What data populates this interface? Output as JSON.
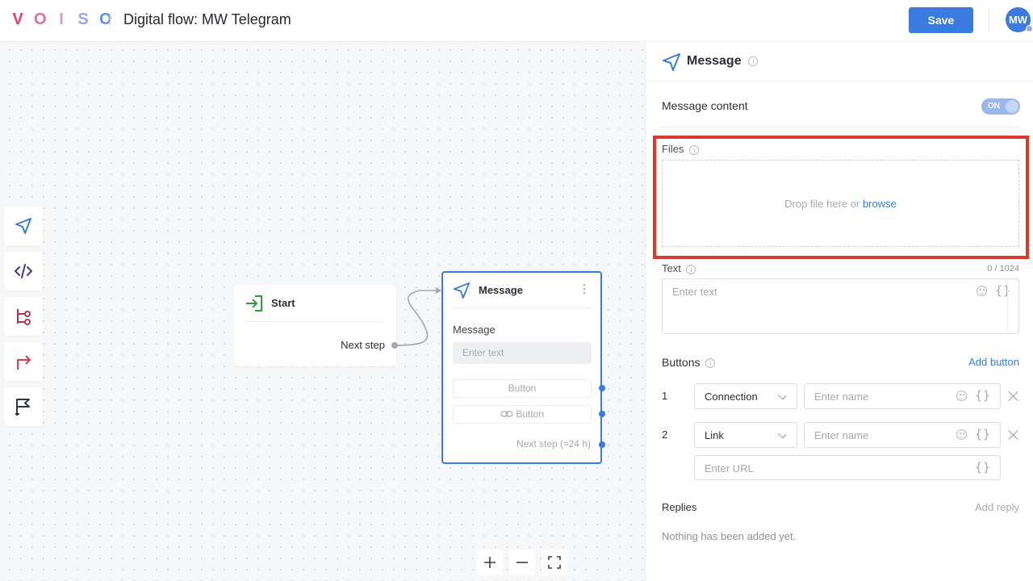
{
  "header": {
    "logo_letters": [
      "V",
      "O",
      "I",
      "S",
      "O"
    ],
    "logo_colors": [
      "#ee3a74",
      "#e66aa8",
      "#c99be8",
      "#9ea2ee",
      "#5b93ee"
    ],
    "title": "Digital flow: MW Telegram",
    "save_label": "Save",
    "avatar_initials": "MW"
  },
  "toolbar": {
    "tools": [
      {
        "icon": "send-icon",
        "label": "Message"
      },
      {
        "icon": "code-icon",
        "label": "Code"
      },
      {
        "icon": "branch-icon",
        "label": "Condition"
      },
      {
        "icon": "redirect-icon",
        "label": "Jump"
      },
      {
        "icon": "flag-icon",
        "label": "Finish"
      }
    ]
  },
  "canvas": {
    "start_node": {
      "title": "Start",
      "next_label": "Next step"
    },
    "message_node": {
      "title": "Message",
      "message_label": "Message",
      "message_placeholder": "Enter text",
      "buttons": [
        "Button",
        "Button"
      ],
      "next_label": "Next step (≈24 h)"
    },
    "zoom_controls": [
      "zoom-in",
      "zoom-out",
      "fit-view"
    ]
  },
  "panel": {
    "title": "Message",
    "message_content_label": "Message content",
    "toggle_label": "ON",
    "toggle_on": true,
    "files_label": "Files",
    "dropzone_text": "Drop file here or ",
    "dropzone_link": "browse",
    "text_label": "Text",
    "text_counter": "0 / 1024",
    "text_placeholder": "Enter text",
    "buttons_label": "Buttons",
    "add_button_label": "Add button",
    "button_rows": [
      {
        "index": "1",
        "type": "Connection",
        "name_placeholder": "Enter name"
      },
      {
        "index": "2",
        "type": "Link",
        "name_placeholder": "Enter name",
        "url_placeholder": "Enter URL"
      }
    ],
    "braces_glyph": "{}",
    "replies_label": "Replies",
    "add_reply_label": "Add reply",
    "replies_empty": "Nothing has been added yet."
  },
  "colors": {
    "accent": "#3a7be0",
    "highlight": "#d93a2a",
    "start_icon": "#2e9a3c",
    "code_icon": "#3b3a8c",
    "branch_icon": "#b8334a",
    "redirect_icon": "#e03a48",
    "flag_icon": "#2c3a40"
  }
}
